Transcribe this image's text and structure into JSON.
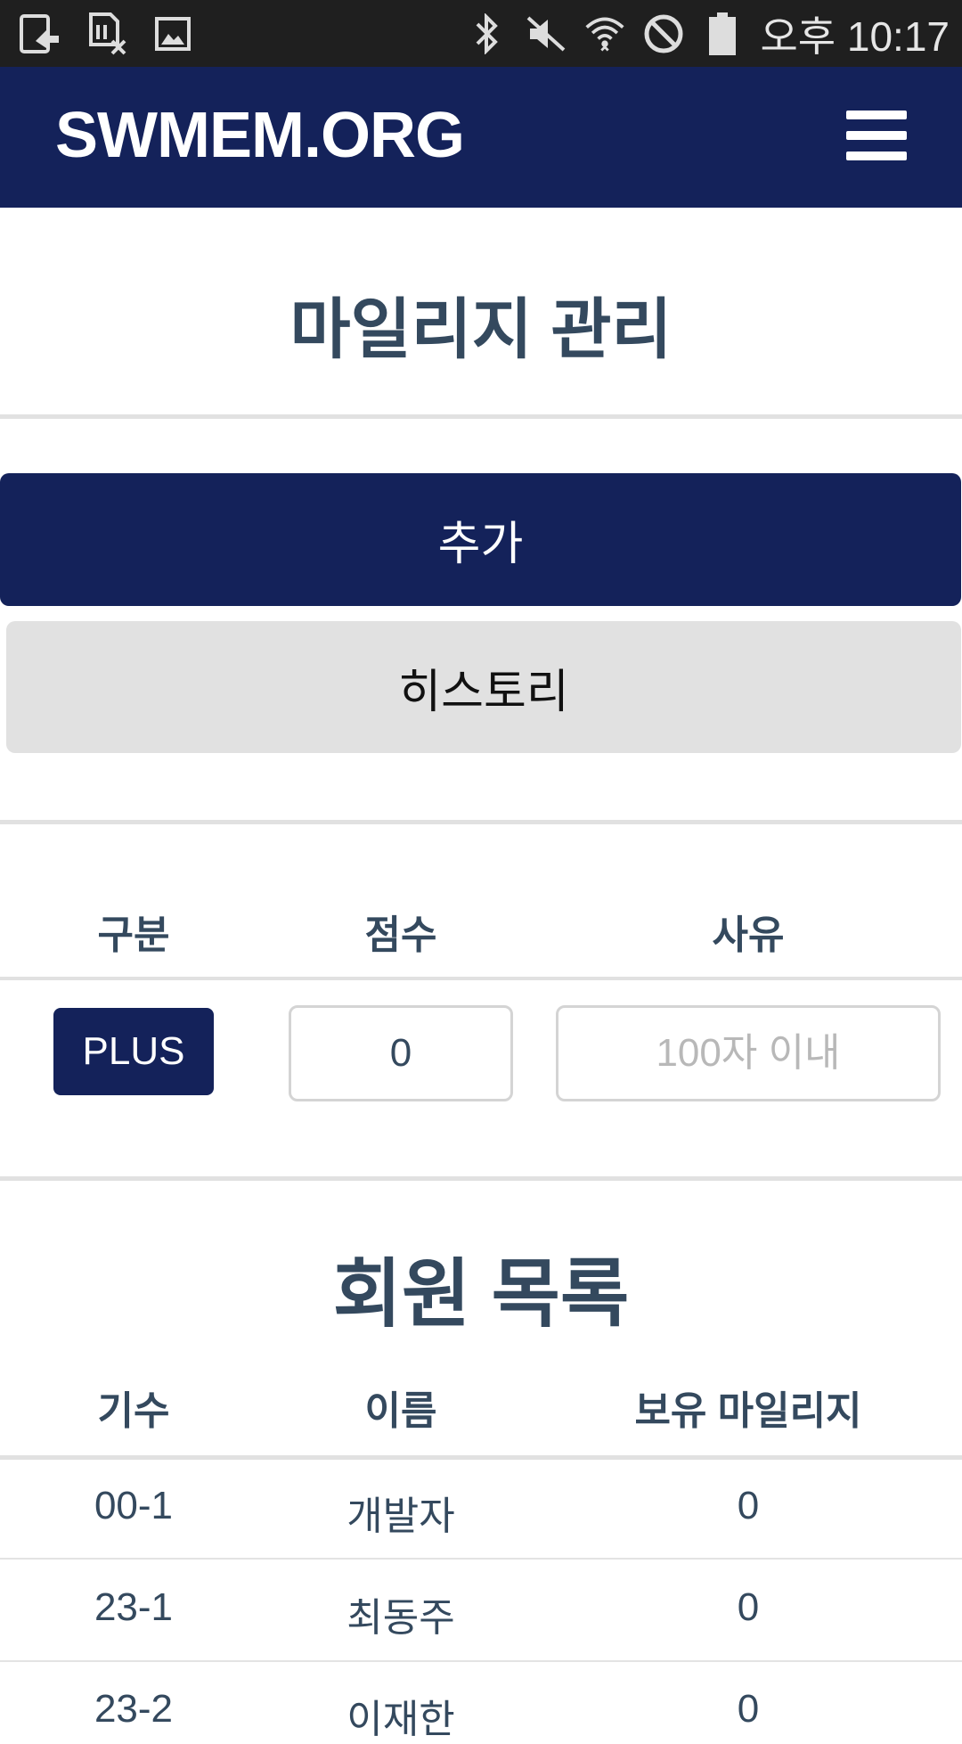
{
  "status_bar": {
    "time": "오후 10:17",
    "left_icons": [
      "screen-share-icon",
      "sim-off-icon",
      "image-icon"
    ],
    "right_icons": [
      "bluetooth-icon",
      "mute-icon",
      "wifi-icon",
      "do-not-disturb-icon",
      "battery-icon"
    ]
  },
  "navbar": {
    "brand": "SWMEM.ORG",
    "menu_icon": "hamburger-menu-icon",
    "color": "#14225a"
  },
  "page": {
    "title": "마일리지 관리"
  },
  "actions": {
    "add_label": "추가",
    "history_label": "히스토리"
  },
  "form": {
    "headers": [
      "구분",
      "점수",
      "사유"
    ],
    "type_button_label": "PLUS",
    "score_value": "0",
    "reason_placeholder": "100자 이내"
  },
  "members": {
    "title": "회원 목록",
    "headers": [
      "기수",
      "이름",
      "보유 마일리지"
    ],
    "rows": [
      {
        "gen": "00-1",
        "name": "개발자",
        "mileage": "0"
      },
      {
        "gen": "23-1",
        "name": "최동주",
        "mileage": "0"
      },
      {
        "gen": "23-2",
        "name": "이재한",
        "mileage": "0"
      }
    ]
  }
}
